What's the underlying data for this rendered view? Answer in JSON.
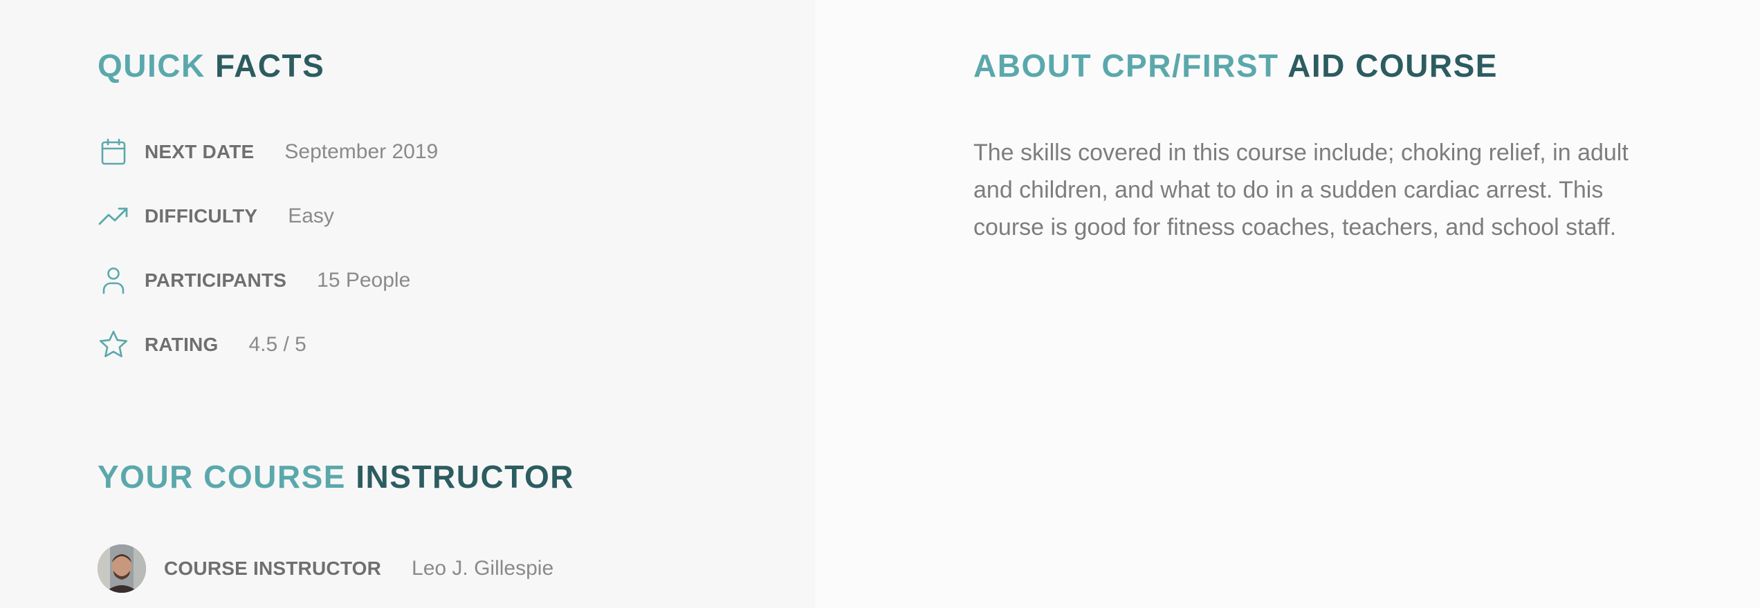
{
  "quick_facts": {
    "title_highlight": "QUICK",
    "title_rest": " FACTS",
    "items": [
      {
        "icon": "calendar-icon",
        "label": "NEXT DATE",
        "value": "September 2019"
      },
      {
        "icon": "trending-up-icon",
        "label": "DIFFICULTY",
        "value": "Easy"
      },
      {
        "icon": "user-icon",
        "label": "PARTICIPANTS",
        "value": "15 People"
      },
      {
        "icon": "star-icon",
        "label": "RATING",
        "value": "4.5 / 5"
      }
    ]
  },
  "instructor": {
    "title_highlight": "YOUR COURSE",
    "title_rest": " INSTRUCTOR",
    "label": "COURSE INSTRUCTOR",
    "name": "Leo J. Gillespie"
  },
  "about": {
    "title_highlight": "ABOUT CPR/FIRST",
    "title_rest": " AID COURSE",
    "text": "The skills covered in this course include; choking relief, in adult and children, and what to do in a sudden cardiac arrest. This course is good for fitness coaches, teachers, and school staff."
  },
  "colors": {
    "accent": "#5aa8ac",
    "heading_dark": "#2c5c60",
    "left_panel_bg": "#f7f7f7",
    "right_panel_bg": "#fbfbfb",
    "label_text": "#6f6f6f",
    "value_text": "#8a8a8a"
  }
}
